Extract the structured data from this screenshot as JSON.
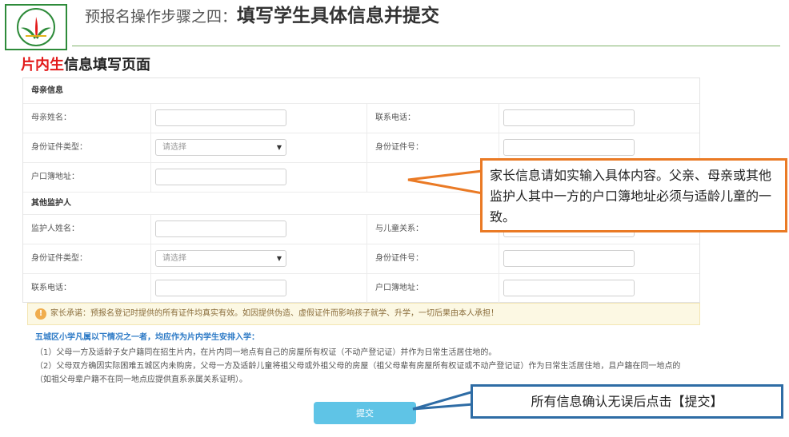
{
  "slide": {
    "title_prefix": "预报名操作步骤之四：",
    "title_main": "填写学生具体信息并提交",
    "subtitle_red": "片内生",
    "subtitle_rest": "信息填写页面"
  },
  "form": {
    "mother_section": "母亲信息",
    "mother_rows": [
      {
        "label_left": "母亲姓名：",
        "field_left": "",
        "label_right": "联系电话：",
        "field_right": ""
      },
      {
        "label_left": "身份证件类型：",
        "select_left": "请选择",
        "label_right": "身份证件号：",
        "field_right": ""
      },
      {
        "label_left": "户口簿地址：",
        "field_left": ""
      }
    ],
    "guardian_section": "其他监护人",
    "guardian_rows": [
      {
        "label_left": "监护人姓名：",
        "field_left": "",
        "label_right": "与儿童关系：",
        "field_right": ""
      },
      {
        "label_left": "身份证件类型：",
        "select_left": "请选择",
        "label_right": "身份证件号：",
        "field_right": ""
      },
      {
        "label_left": "联系电话：",
        "field_left": "",
        "label_right": "户口簿地址：",
        "field_right": ""
      }
    ],
    "select_arrow": "▼"
  },
  "notice": {
    "icon": "!",
    "text": "家长承诺：预报名登记时提供的所有证件均真实有效。如因提供伪造、虚假证件而影响孩子就学、升学，一切后果由本人承担！"
  },
  "rules": {
    "heading": "五城区小学凡属以下情况之一者，均应作为片内学生安排入学：",
    "item1": "（1）父母一方及适龄子女户籍同在招生片内，在片内同一地点有自己的房屋所有权证（不动产登记证）并作为日常生活居住地的。",
    "item2": "（2）父母双方确因实际困难五城区内未购房，父母一方及适龄儿童将祖父母或外祖父母的房屋（祖父母辈有房屋所有权证或不动产登记证）作为日常生活居住地，且户籍在同一地点的（如祖父母辈户籍不在同一地点应提供直系亲属关系证明）。"
  },
  "submit_label": "提交",
  "callouts": {
    "info": "家长信息请如实输入具体内容。父亲、母亲或其他监护人其中一方的户口簿地址必须与适龄儿童的一致。",
    "submit": "所有信息确认无误后点击【提交】"
  },
  "colors": {
    "accent_red": "#e21a1a",
    "callout_orange": "#ea7a25",
    "callout_blue": "#2e6ca5",
    "submit_blue": "#5fc4e6",
    "logo_green": "#2e8b3a"
  }
}
